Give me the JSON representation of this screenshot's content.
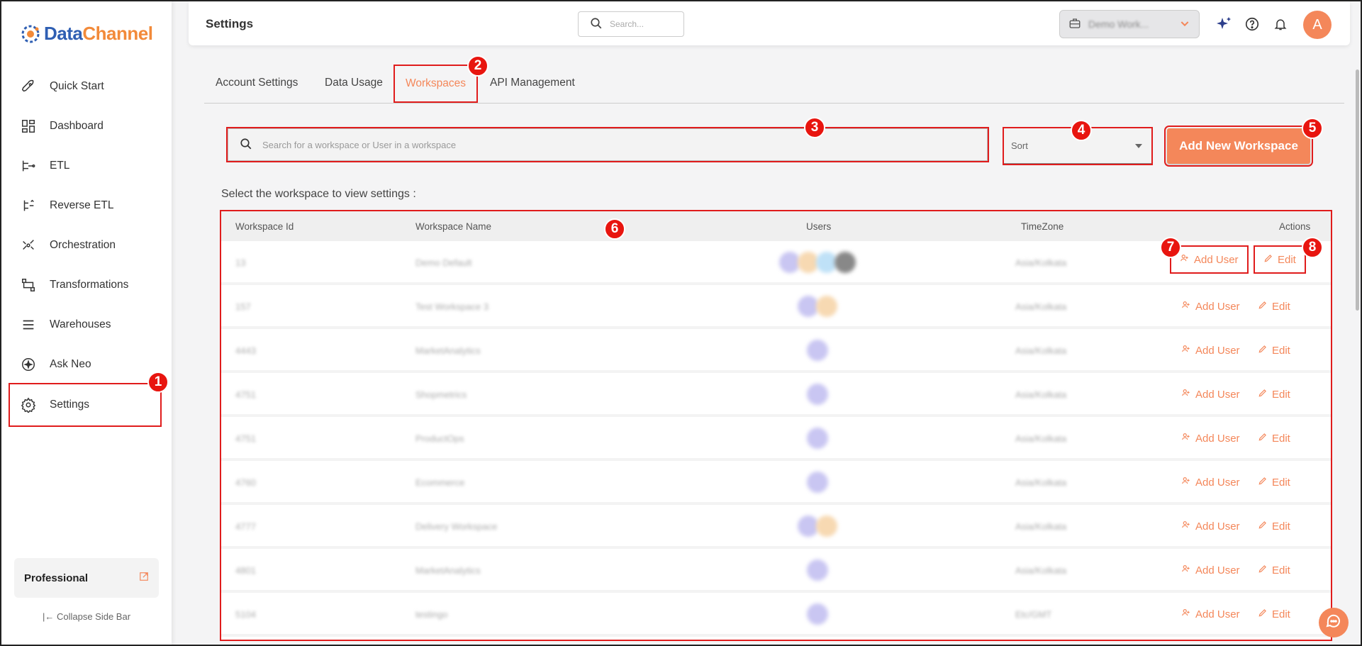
{
  "brand": {
    "name_part1": "Data",
    "name_part2": "Channel"
  },
  "sidebar": {
    "items": [
      {
        "label": "Quick Start",
        "icon": "rocket-icon"
      },
      {
        "label": "Dashboard",
        "icon": "dashboard-icon"
      },
      {
        "label": "ETL",
        "icon": "etl-icon"
      },
      {
        "label": "Reverse ETL",
        "icon": "reverse-etl-icon"
      },
      {
        "label": "Orchestration",
        "icon": "orchestration-icon"
      },
      {
        "label": "Transformations",
        "icon": "transformations-icon"
      },
      {
        "label": "Warehouses",
        "icon": "warehouses-icon"
      },
      {
        "label": "Ask Neo",
        "icon": "sparkle-icon"
      },
      {
        "label": "Settings",
        "icon": "gear-icon"
      }
    ],
    "plan": "Professional",
    "collapse": "Collapse Side Bar"
  },
  "header": {
    "title": "Settings",
    "search_placeholder": "Search...",
    "workspace_selected": "Demo Work...",
    "avatar_letter": "A"
  },
  "tabs": [
    "Account Settings",
    "Data Usage",
    "Workspaces",
    "API Management"
  ],
  "active_tab": "Workspaces",
  "search": {
    "placeholder": "Search for a workspace or User in a workspace"
  },
  "sort": {
    "label": "Sort"
  },
  "add_workspace_label": "Add New Workspace",
  "select_label": "Select the workspace to view settings :",
  "table": {
    "columns": [
      "Workspace Id",
      "Workspace Name",
      "Users",
      "TimeZone",
      "Actions"
    ],
    "rows": [
      {
        "id": "13",
        "name": "Demo Default",
        "users": [
          "#c9c6f2",
          "#f7d9b2",
          "#bfe1f7",
          "#888888"
        ],
        "tz": "Asia/Kolkata"
      },
      {
        "id": "157",
        "name": "Test Workspace 3",
        "users": [
          "#c9c6f2",
          "#f7d9b2"
        ],
        "tz": "Asia/Kolkata"
      },
      {
        "id": "4443",
        "name": "MarketAnalytics",
        "users": [
          "#c9c6f2"
        ],
        "tz": "Asia/Kolkata"
      },
      {
        "id": "4751",
        "name": "Shopmetrics",
        "users": [
          "#c9c6f2"
        ],
        "tz": "Asia/Kolkata"
      },
      {
        "id": "4751",
        "name": "ProductOps",
        "users": [
          "#c9c6f2"
        ],
        "tz": "Asia/Kolkata"
      },
      {
        "id": "4760",
        "name": "Ecommerce",
        "users": [
          "#c9c6f2"
        ],
        "tz": "Asia/Kolkata"
      },
      {
        "id": "4777",
        "name": "Delivery Workspace",
        "users": [
          "#c9c6f2",
          "#f7d9b2"
        ],
        "tz": "Asia/Kolkata"
      },
      {
        "id": "4801",
        "name": "MarketAnalytics",
        "users": [
          "#c9c6f2"
        ],
        "tz": "Asia/Kolkata"
      },
      {
        "id": "5104",
        "name": "testingo",
        "users": [
          "#c9c6f2"
        ],
        "tz": "Etc/GMT"
      }
    ],
    "add_user_label": "Add User",
    "edit_label": "Edit"
  },
  "badges": [
    "1",
    "2",
    "3",
    "4",
    "5",
    "6",
    "7",
    "8"
  ],
  "colors": {
    "accent": "#f4875a",
    "highlight": "#e01c1c",
    "badge": "#e8150f"
  }
}
